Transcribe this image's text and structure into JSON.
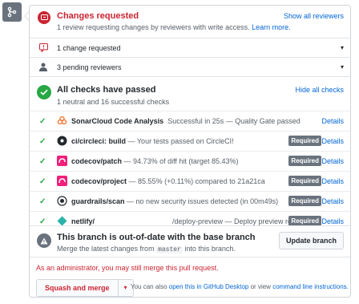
{
  "review": {
    "title": "Changes requested",
    "subtitle": "1 review requesting changes by reviewers with write access.",
    "learn_more": "Learn more.",
    "show_all": "Show all reviewers"
  },
  "change_requested": "1 change requested",
  "pending_reviewers": "3 pending reviewers",
  "checks": {
    "title": "All checks have passed",
    "subtitle": "1 neutral and 16 successful checks",
    "hide_all": "Hide all checks",
    "items": [
      {
        "name": "SonarCloud Code Analysis",
        "desc": "Successful in 25s — Quality Gate passed",
        "required": "",
        "details": "Details"
      },
      {
        "name": "ci/circleci: build",
        "desc": "— Your tests passed on CircleCI!",
        "required": "Required",
        "details": "Details"
      },
      {
        "name": "codecov/patch",
        "desc": "— 94.73% of diff hit (target 85.43%)",
        "required": "Required",
        "details": "Details"
      },
      {
        "name": "codecov/project",
        "desc": "— 85.55% (+0.11%) compared to 21a21ca",
        "required": "Required",
        "details": "Details"
      },
      {
        "name": "guardrails/scan",
        "desc": "— no new security issues detected (in 00m49s)",
        "required": "Required",
        "details": "Details"
      },
      {
        "name": "netlify/",
        "desc": "/deploy-preview — Deploy preview rea...",
        "required": "Required",
        "details": "Details"
      }
    ]
  },
  "branch": {
    "title": "This branch is out-of-date with the base branch",
    "desc_prefix": "Merge the latest changes from",
    "desc_code": "master",
    "desc_suffix": "into this branch.",
    "update_button": "Update branch"
  },
  "admin_note": "As an administrator, you may still merge this pull request.",
  "merge": {
    "button": "Squash and merge",
    "also_prefix": "You can also",
    "desktop_link": "open this in GitHub Desktop",
    "or_view": "or view",
    "cli_link": "command line instructions",
    "period": "."
  },
  "colors": {
    "danger": "#cb2431",
    "success": "#28a745",
    "link": "#0366d6"
  }
}
